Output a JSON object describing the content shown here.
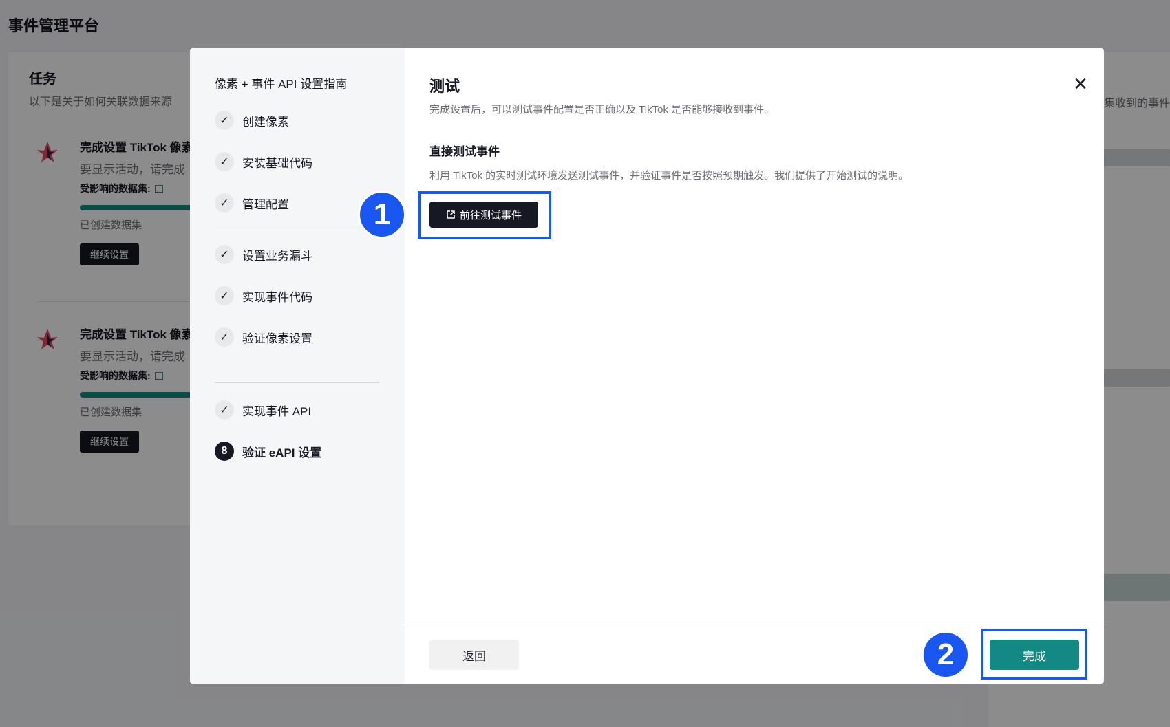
{
  "background": {
    "app_title": "事件管理平台",
    "tasks_title": "任务",
    "tasks_subtitle": "以下是关于如何关联数据来源",
    "right_snippet": "集收到的事件",
    "tasks": [
      {
        "title": "完成设置 TikTok 像素",
        "desc": "要显示活动，请完成",
        "affected_label": "受影响的数据集:",
        "status": "已创建数据集",
        "button": "继续设置"
      },
      {
        "title": "完成设置 TikTok 像素",
        "desc": "要显示活动，请完成",
        "affected_label": "受影响的数据集:",
        "status": "已创建数据集",
        "button": "继续设置"
      }
    ]
  },
  "modal": {
    "guide_title": "像素 + 事件 API 设置指南",
    "steps": [
      {
        "label": "创建像素",
        "state": "done"
      },
      {
        "label": "安装基础代码",
        "state": "done"
      },
      {
        "label": "管理配置",
        "state": "done"
      },
      {
        "label": "设置业务漏斗",
        "state": "done"
      },
      {
        "label": "实现事件代码",
        "state": "done"
      },
      {
        "label": "验证像素设置",
        "state": "done"
      },
      {
        "label": "实现事件 API",
        "state": "done"
      },
      {
        "label": "验证 eAPI 设置",
        "state": "active",
        "number": "8"
      }
    ],
    "check_glyph": "✓",
    "title": "测试",
    "description": "完成设置后，可以测试事件配置是否正确以及 TikTok 是否能够接收到事件。",
    "section_title": "直接测试事件",
    "section_desc": "利用 TikTok 的实时测试环境发送测试事件，并验证事件是否按照预期触发。我们提供了开始测试的说明。",
    "go_button": "前往测试事件",
    "back_button": "返回",
    "done_button": "完成",
    "close_glyph": "✕"
  },
  "annotations": {
    "badge_1": "1",
    "badge_2": "2",
    "highlight_color": "#1a56f0"
  },
  "colors": {
    "brand_teal": "#128a83",
    "dark_button": "#161823"
  }
}
